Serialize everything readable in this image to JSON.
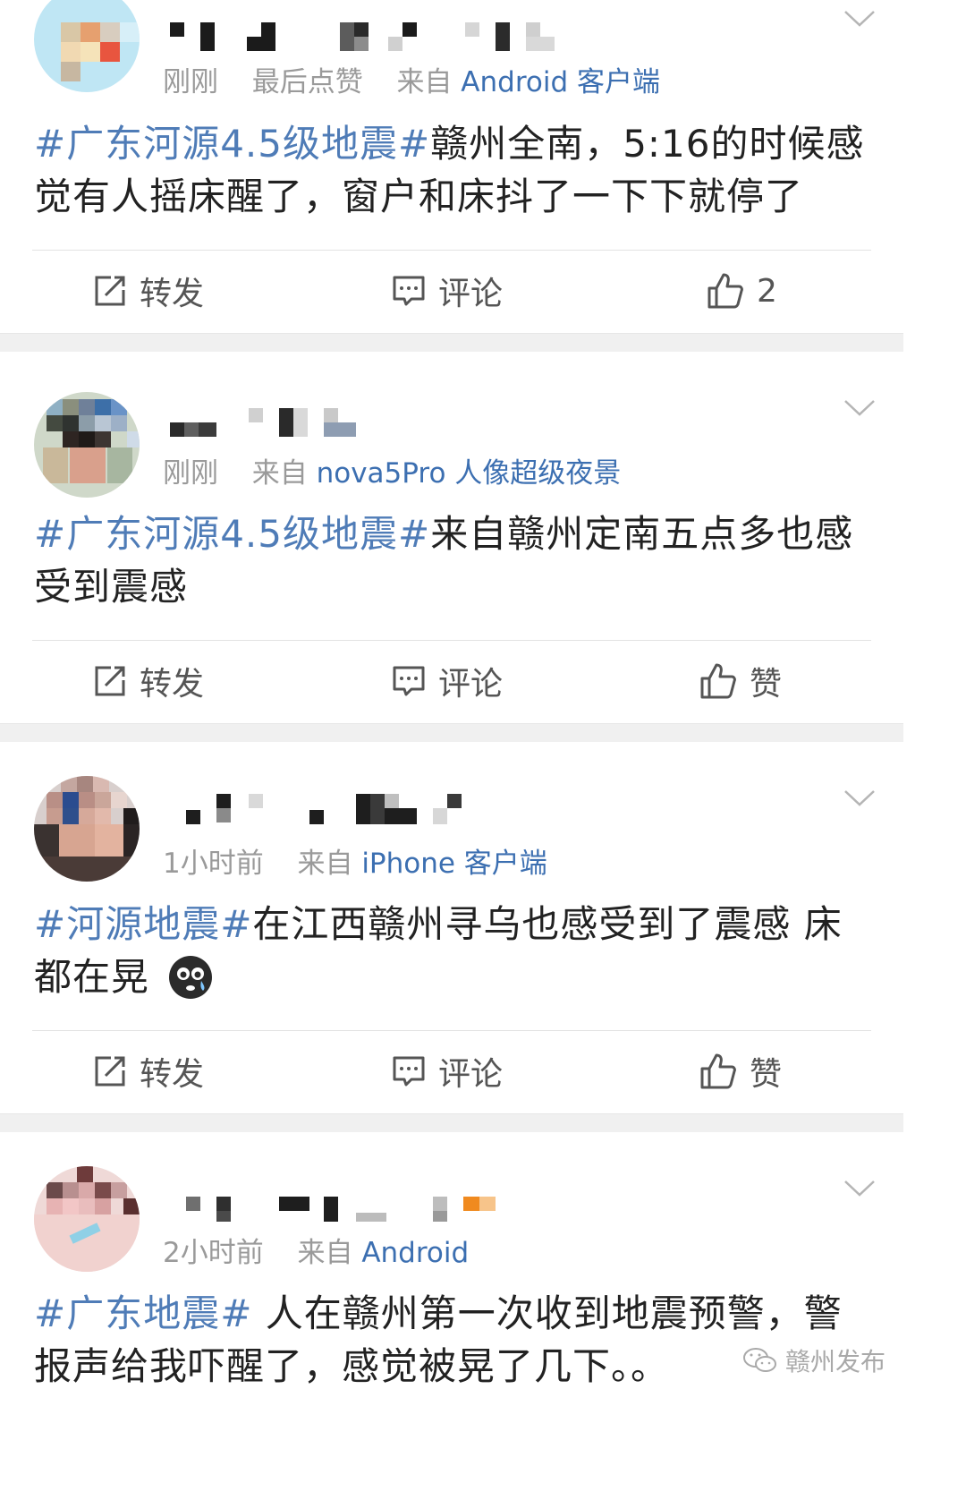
{
  "posts": [
    {
      "meta_time": "刚刚",
      "meta_extra": "最后点赞",
      "meta_prefix": "来自",
      "meta_source": "Android 客户端",
      "tag": "#广东河源4.5级地震#",
      "text": "赣州全南，5:16的时候感觉有人摇床醒了，窗户和床抖了一下下就停了",
      "repost_label": "转发",
      "comment_label": "评论",
      "like_label": "2"
    },
    {
      "meta_time": "刚刚",
      "meta_prefix": "来自",
      "meta_source": "nova5Pro 人像超级夜景",
      "tag": "#广东河源4.5级地震#",
      "text": "来自赣州定南五点多也感受到震感",
      "repost_label": "转发",
      "comment_label": "评论",
      "like_label": "赞"
    },
    {
      "meta_time": "1小时前",
      "meta_prefix": "来自",
      "meta_source": "iPhone 客户端",
      "tag": "#河源地震#",
      "text": "在江西赣州寻乌也感受到了震感 床都在晃",
      "emoji": "crying-face-icon",
      "repost_label": "转发",
      "comment_label": "评论",
      "like_label": "赞"
    },
    {
      "meta_time": "2小时前",
      "meta_prefix": "来自",
      "meta_source": "Android",
      "tag": "#广东地震#",
      "text": " 人在赣州第一次收到地震预警，警报声给我吓醒了，感觉被晃了几下。。",
      "repost_label": "转发",
      "comment_label": "评论",
      "like_label": "赞"
    }
  ],
  "watermark": {
    "text": "赣州发布",
    "icon": "wechat-icon"
  },
  "colors": {
    "link": "#4f7cb7",
    "source": "#3c6fb1",
    "meta": "#9a9a9a",
    "text": "#222222",
    "divider": "#f0f0f0"
  }
}
